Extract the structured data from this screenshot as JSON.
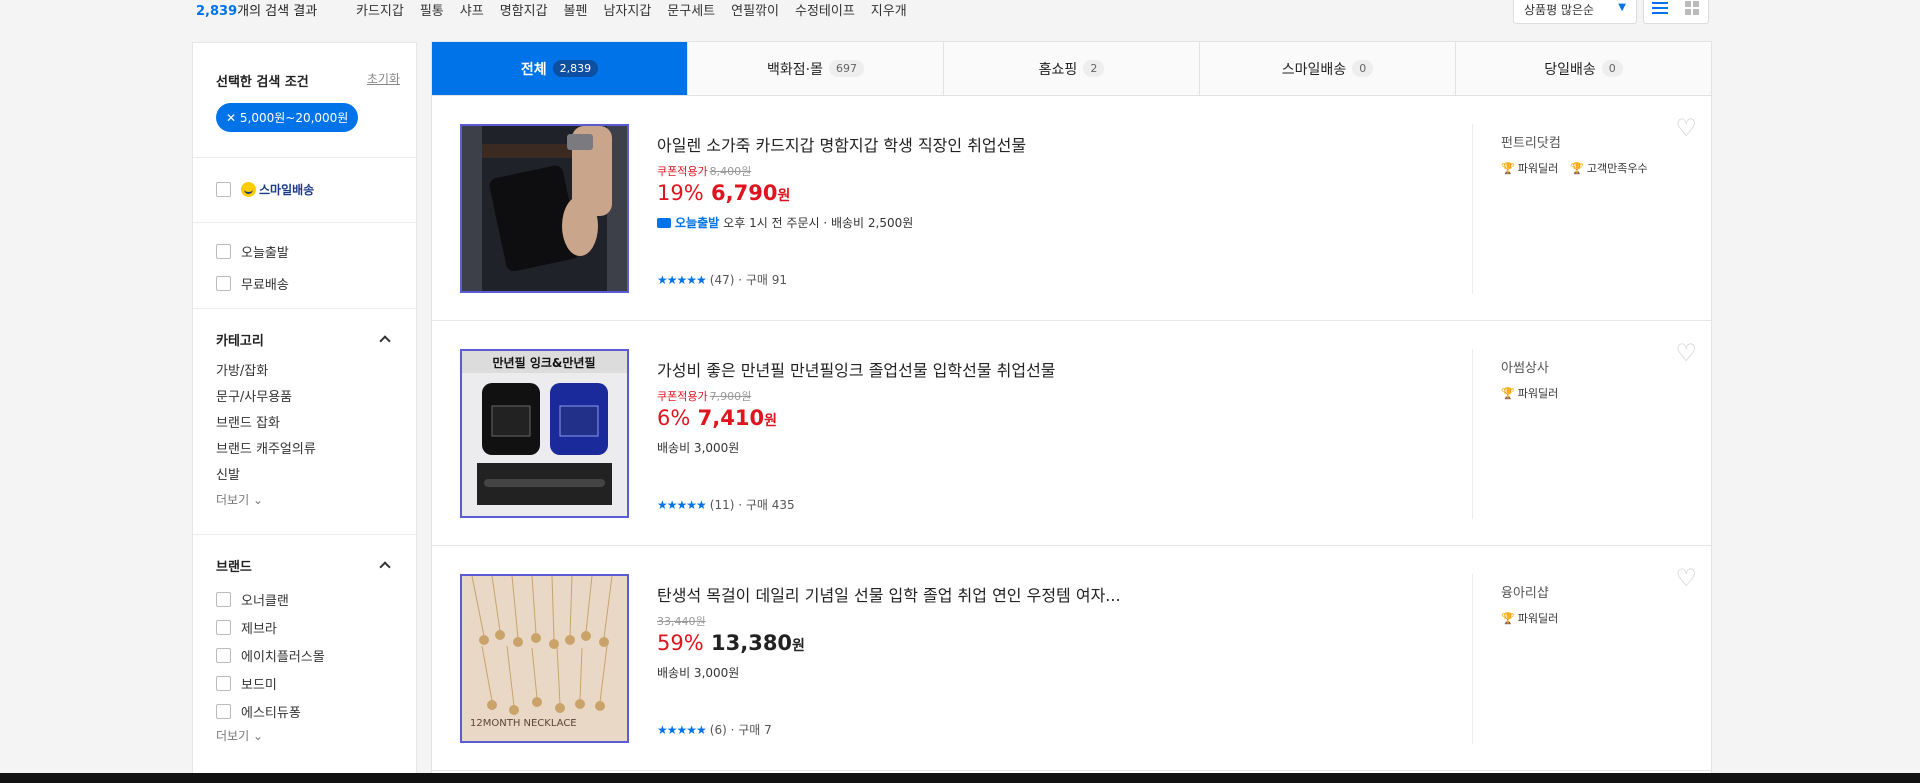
{
  "topbar": {
    "count_num": "2,839",
    "count_suffix": "개의 검색 결과",
    "keywords": [
      "카드지갑",
      "필통",
      "샤프",
      "명함지갑",
      "볼펜",
      "남자지갑",
      "문구세트",
      "연필깎이",
      "수정테이프",
      "지우개"
    ],
    "sort_label": "상품평 많은순"
  },
  "sidebar": {
    "selected_title": "선택한 검색 조건",
    "reset_label": "초기화",
    "chip_label": "✕ 5,000원~20,000원",
    "smile_label": "스마일배송",
    "delivery_options": [
      "오늘출발",
      "무료배송"
    ],
    "category_title": "카테고리",
    "categories": [
      "가방/잡화",
      "문구/사무용품",
      "브랜드 잡화",
      "브랜드 캐주얼의류",
      "신발"
    ],
    "more_label": "더보기",
    "brand_title": "브랜드",
    "brands": [
      "오너클랜",
      "제브라",
      "에이치플러스몰",
      "보드미",
      "에스티듀퐁"
    ]
  },
  "tabs": [
    {
      "label": "전체",
      "count": "2,839"
    },
    {
      "label": "백화점·몰",
      "count": "697"
    },
    {
      "label": "홈쇼핑",
      "count": "2"
    },
    {
      "label": "스마일배송",
      "count": "0"
    },
    {
      "label": "당일배송",
      "count": "0"
    }
  ],
  "products": [
    {
      "title": "아일렌 소가죽 카드지갑 명함지갑 학생 직장인 취업선물",
      "coupon_label": "쿠폰적용가",
      "orig_price": "8,400원",
      "rate": "19%",
      "price": "6,790",
      "won": "원",
      "today": "오늘출발",
      "ship_text": "오후 1시 전 주문시 · 배송비 2,500원",
      "stars": "★★★★★",
      "reviews": "(47) · 구매 91",
      "seller": "펀트리닷컴",
      "badge1": "파워딜러",
      "badge2": "고객만족우수"
    },
    {
      "title": "가성비 좋은 만년필 만년필잉크 졸업선물 입학선물 취업선물",
      "coupon_label": "쿠폰적용가",
      "orig_price": "7,900원",
      "rate": "6%",
      "price": "7,410",
      "won": "원",
      "ship_text": "배송비 3,000원",
      "stars": "★★★★★",
      "reviews": "(11) · 구매 435",
      "seller": "아썸상사",
      "badge1": "파워딜러",
      "thumb_text": "만년필 잉크&만년필"
    },
    {
      "title": "탄생석 목걸이 데일리 기념일 선물 입학 졸업 취업 연인 우정템 여자...",
      "orig_price": "33,440원",
      "rate": "59%",
      "price": "13,380",
      "won": "원",
      "ship_text": "배송비 3,000원",
      "stars": "★★★★★",
      "reviews": "(6) · 구매 7",
      "seller": "융아리샵",
      "badge1": "파워딜러",
      "thumb_text": "12MONTH NECKLACE"
    }
  ]
}
